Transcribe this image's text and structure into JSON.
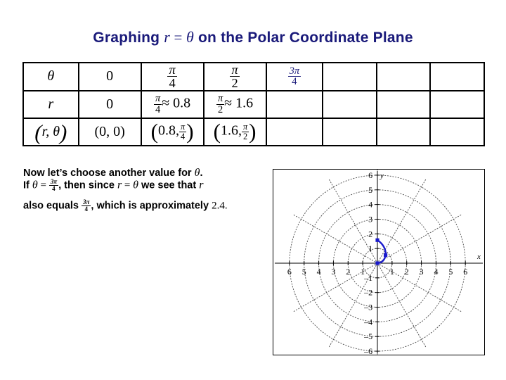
{
  "title": {
    "part1": "Graphing ",
    "var_r": "r",
    "equals": " = ",
    "var_theta": "θ",
    "part2": " on the Polar Coordinate Plane"
  },
  "table": {
    "rows": [
      {
        "label": "θ",
        "cells": [
          {
            "text": "0",
            "kind": "plain"
          },
          {
            "text": "π/4",
            "kind": "frac",
            "num": "π",
            "den": "4"
          },
          {
            "text": "π/2",
            "kind": "frac",
            "num": "π",
            "den": "2"
          },
          {
            "text": "3π/4",
            "kind": "frac-blue",
            "num": "3π",
            "den": "4"
          },
          {
            "text": "",
            "kind": "empty"
          },
          {
            "text": "",
            "kind": "empty"
          },
          {
            "text": "",
            "kind": "empty"
          },
          {
            "text": "",
            "kind": "empty"
          }
        ]
      },
      {
        "label": "r",
        "cells": [
          {
            "text": "0",
            "kind": "plain"
          },
          {
            "text": "π/4 ≈ 0.8",
            "kind": "frac-approx",
            "num": "π",
            "den": "4",
            "approx": "≈ 0.8"
          },
          {
            "text": "π/2 ≈ 1.6",
            "kind": "frac-approx",
            "num": "π",
            "den": "2",
            "approx": "≈ 1.6"
          },
          {
            "text": "",
            "kind": "empty"
          },
          {
            "text": "",
            "kind": "empty"
          },
          {
            "text": "",
            "kind": "empty"
          },
          {
            "text": "",
            "kind": "empty"
          },
          {
            "text": "",
            "kind": "empty"
          }
        ]
      },
      {
        "label": "(r, θ)",
        "cells": [
          {
            "text": "(0, 0)",
            "kind": "pair-plain",
            "first": "0",
            "second": "0"
          },
          {
            "text": "(0.8, π/4)",
            "kind": "pair-frac",
            "first": "0.8",
            "num": "π",
            "den": "4"
          },
          {
            "text": "(1.6, π/2)",
            "kind": "pair-frac",
            "first": "1.6",
            "num": "π",
            "den": "2"
          },
          {
            "text": "",
            "kind": "empty"
          },
          {
            "text": "",
            "kind": "empty"
          },
          {
            "text": "",
            "kind": "empty"
          },
          {
            "text": "",
            "kind": "empty"
          },
          {
            "text": "",
            "kind": "empty"
          }
        ]
      }
    ]
  },
  "prose": {
    "p1_a": "Now let’s choose another value for ",
    "p1_var": "θ",
    "p1_b": ".",
    "p2_l1_a": "If ",
    "p2_l1_theta": "θ",
    "p2_l1_eq": " = ",
    "p2_l1_num": "3π",
    "p2_l1_den": "4",
    "p2_l1_b": ", then since ",
    "p2_l1_r": "r",
    "p2_l1_eq2": " = ",
    "p2_l1_theta2": "θ",
    "p2_l1_c": " we see that ",
    "p2_l1_r2": "r",
    "p2_l2_a": "also equals ",
    "p2_l2_num": "3π",
    "p2_l2_den": "4",
    "p2_l2_b": ", which is approximately ",
    "p2_l2_val": "2.4",
    "p2_l2_c": "."
  },
  "plot": {
    "x_axis_label": "x",
    "y_axis_label": "y",
    "x_ticks_left": [
      "6",
      "5",
      "4",
      "3",
      "2",
      "1"
    ],
    "x_ticks_right": [
      "1",
      "2",
      "3",
      "4",
      "5",
      "6"
    ],
    "y_ticks_up": [
      "1",
      "2",
      "3",
      "4",
      "5",
      "6"
    ],
    "y_ticks_down": [
      "–1",
      "–2",
      "–3",
      "–4",
      "–5",
      "–6"
    ],
    "grid_color": "#555555",
    "curve_color": "#1a1acc",
    "marker_color": "#1a1acc"
  },
  "chart_data": {
    "type": "line",
    "title": "Polar graph of r = θ",
    "xlabel": "x",
    "ylabel": "y",
    "xlim": [
      -6.8,
      6.8
    ],
    "ylim": [
      -6.5,
      6.5
    ],
    "grid": "polar-dotted",
    "polar_radii": [
      1,
      2,
      3,
      4,
      5,
      6
    ],
    "polar_angles_deg": [
      0,
      30,
      60,
      90,
      120,
      150,
      180,
      210,
      240,
      270,
      300,
      330
    ],
    "series": [
      {
        "name": "r = θ",
        "theta_radians": [
          0,
          0.3927,
          0.7854,
          1.1781,
          1.5708
        ],
        "r_values": [
          0,
          0.3927,
          0.7854,
          1.1781,
          1.5708
        ],
        "points_xy": [
          [
            0,
            0
          ],
          [
            0.363,
            0.15
          ],
          [
            0.555,
            0.555
          ],
          [
            0.45,
            1.089
          ],
          [
            0,
            1.571
          ]
        ]
      }
    ],
    "markers": [
      {
        "label": "(0, 0)",
        "x": 0,
        "y": 0
      },
      {
        "label": "(0.8, π/4)",
        "x": 0.555,
        "y": 0.555
      },
      {
        "label": "(1.6, π/2)",
        "x": 0,
        "y": 1.571
      }
    ]
  }
}
